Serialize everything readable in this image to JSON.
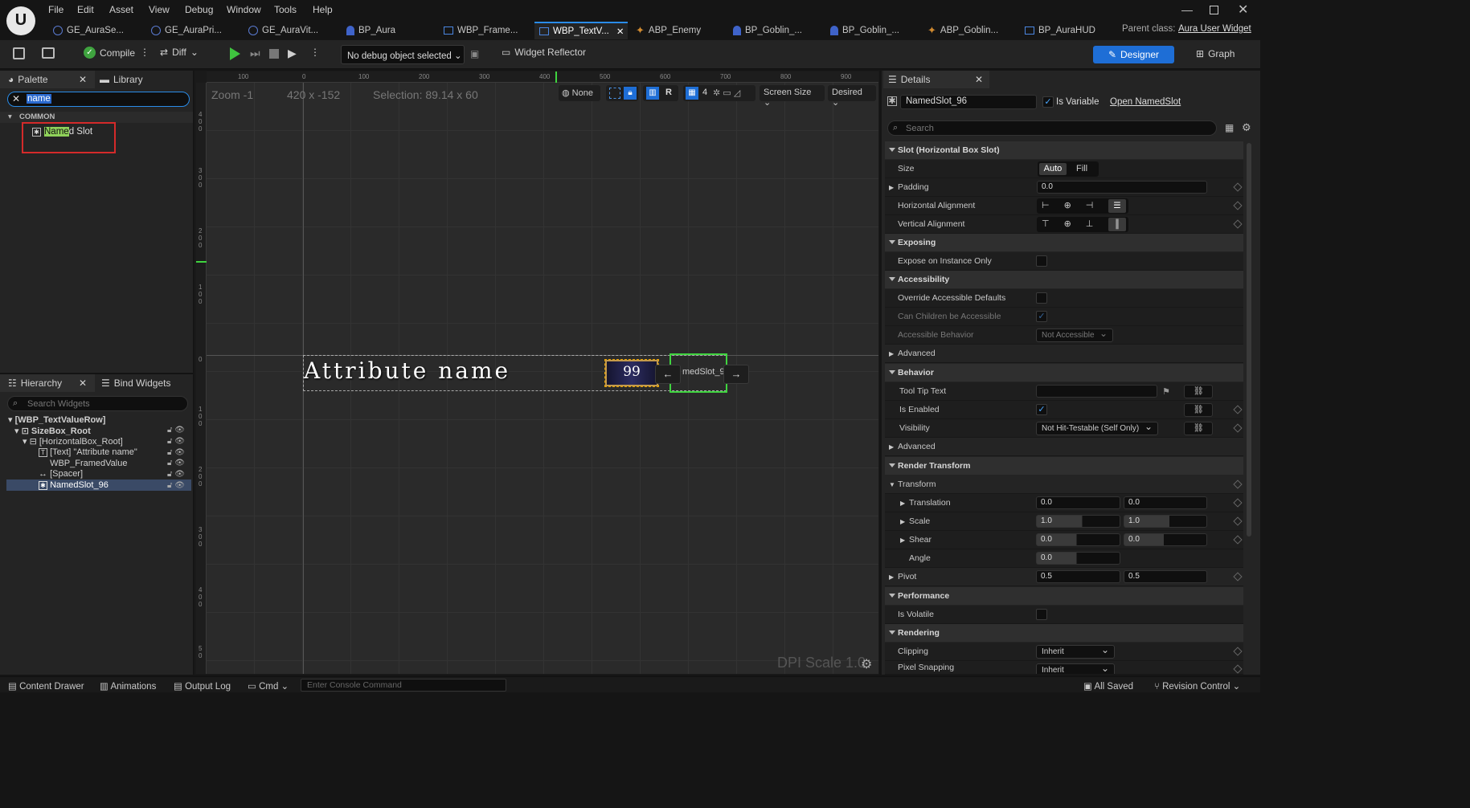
{
  "menu": [
    "File",
    "Edit",
    "Asset",
    "View",
    "Debug",
    "Window",
    "Tools",
    "Help"
  ],
  "tabs": [
    {
      "label": "GE_AuraSe...",
      "icon": "gameplay-effect-icon"
    },
    {
      "label": "GE_AuraPri...",
      "icon": "gameplay-effect-icon"
    },
    {
      "label": "GE_AuraVit...",
      "icon": "gameplay-effect-icon"
    },
    {
      "label": "BP_Aura",
      "icon": "character-icon"
    },
    {
      "label": "WBP_Frame...",
      "icon": "widget-blueprint-icon"
    },
    {
      "label": "WBP_TextV...",
      "icon": "widget-blueprint-icon"
    },
    {
      "label": "ABP_Enemy",
      "icon": "anim-blueprint-icon"
    },
    {
      "label": "BP_Goblin_...",
      "icon": "character-icon"
    },
    {
      "label": "BP_Goblin_...",
      "icon": "character-icon"
    },
    {
      "label": "ABP_Goblin...",
      "icon": "anim-blueprint-icon"
    },
    {
      "label": "BP_AuraHUD",
      "icon": "hud-icon"
    }
  ],
  "parent_class": {
    "label": "Parent class:",
    "value": "Aura User Widget"
  },
  "toolbar": {
    "compile": "Compile",
    "diff": "Diff",
    "debug_object": "No debug object selected",
    "widget_reflector": "Widget Reflector",
    "designer": "Designer",
    "graph": "Graph"
  },
  "palette": {
    "tab": "Palette",
    "library_tab": "Library",
    "search_value": "name",
    "category": "COMMON",
    "result_highlight": "Name",
    "result_rest": "d Slot"
  },
  "hierarchy": {
    "tab": "Hierarchy",
    "bind_tab": "Bind Widgets",
    "search_placeholder": "Search Widgets",
    "items": [
      "[WBP_TextValueRow]",
      "SizeBox_Root",
      "[HorizontalBox_Root]",
      "[Text] \"Attribute name\"",
      "WBP_FramedValue",
      "[Spacer]",
      "NamedSlot_96"
    ]
  },
  "canvas": {
    "zoom": "Zoom -1",
    "coords": "420 x -152",
    "selection": "Selection: 89.14 x 60",
    "none": "None",
    "r": "R",
    "grid": "4",
    "screen_size": "Screen Size",
    "desired": "Desired",
    "attribute_text": "Attribute name",
    "value_text": "99",
    "slot_text": "medSlot_9(",
    "dpi": "DPI Scale 1.0",
    "ruler_h": [
      "100",
      "0",
      "100",
      "200",
      "300",
      "400",
      "500",
      "600",
      "700",
      "800",
      "900"
    ],
    "ruler_v": [
      "4 0 0",
      "3 0 0",
      "2 0 0",
      "1 0 0",
      "0",
      "1 0 0",
      "2 0 0",
      "3 0 0",
      "4 0 0",
      "5 0"
    ]
  },
  "details": {
    "tab": "Details",
    "name": "NamedSlot_96",
    "is_variable": "Is Variable",
    "open": "Open NamedSlot",
    "search_placeholder": "Search",
    "slot_section": "Slot (Horizontal Box Slot)",
    "size": "Size",
    "auto": "Auto",
    "fill": "Fill",
    "padding": "Padding",
    "padding_value": "0.0",
    "h_align": "Horizontal Alignment",
    "v_align": "Vertical Alignment",
    "exposing": "Exposing",
    "expose_instance": "Expose on Instance Only",
    "accessibility": "Accessibility",
    "override_access": "Override Accessible Defaults",
    "children_access": "Can Children be Accessible",
    "access_behavior": "Accessible Behavior",
    "not_accessible": "Not Accessible",
    "advanced": "Advanced",
    "behavior": "Behavior",
    "tooltip": "Tool Tip Text",
    "is_enabled": "Is Enabled",
    "visibility": "Visibility",
    "visibility_value": "Not Hit-Testable (Self Only)",
    "advanced2": "Advanced",
    "render_transform": "Render Transform",
    "transform": "Transform",
    "translation": "Translation",
    "t_x": "0.0",
    "t_y": "0.0",
    "scale": "Scale",
    "s_x": "1.0",
    "s_y": "1.0",
    "shear": "Shear",
    "sh_x": "0.0",
    "sh_y": "0.0",
    "angle": "Angle",
    "angle_value": "0.0",
    "pivot": "Pivot",
    "p_x": "0.5",
    "p_y": "0.5",
    "performance": "Performance",
    "is_volatile": "Is Volatile",
    "rendering": "Rendering",
    "clipping": "Clipping",
    "clipping_value": "Inherit",
    "pixel_snapping": "Pixel Snapping",
    "pixel_value": "Inherit"
  },
  "statusbar": {
    "content_drawer": "Content Drawer",
    "animations": "Animations",
    "output_log": "Output Log",
    "cmd": "Cmd",
    "console_placeholder": "Enter Console Command",
    "all_saved": "All Saved",
    "revision": "Revision Control"
  }
}
